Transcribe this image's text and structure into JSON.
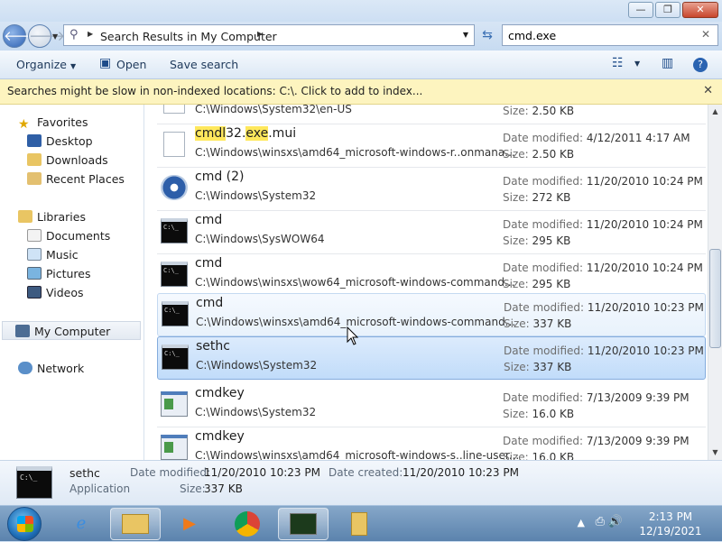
{
  "window": {
    "controls": {
      "minimize": "—",
      "maximize": "❐",
      "close": "✕"
    }
  },
  "address": {
    "crumb": "Search Results in My Computer",
    "search_value": "cmd.exe"
  },
  "toolbar": {
    "organize": "Organize",
    "open": "Open",
    "save_search": "Save search"
  },
  "infobar": {
    "message": "Searches might be slow in non-indexed locations: C:\\. Click to add to index..."
  },
  "navpane": {
    "favorites": {
      "label": "Favorites",
      "items": [
        "Desktop",
        "Downloads",
        "Recent Places"
      ]
    },
    "libraries": {
      "label": "Libraries",
      "items": [
        "Documents",
        "Music",
        "Pictures",
        "Videos"
      ]
    },
    "computer": "My Computer",
    "network": "Network"
  },
  "results": [
    {
      "name": "",
      "path": "C:\\Windows\\System32\\en-US",
      "date_label": "",
      "date": "",
      "size_label": "Size:",
      "size": "2.50 KB"
    },
    {
      "name_hl1": "cmdl",
      "name_mid": "32.",
      "name_hl2": "exe",
      "name_end": ".mui",
      "path": "C:\\Windows\\winsxs\\amd64_microsoft-windows-r..onmana...",
      "date_label": "Date modified:",
      "date": "4/12/2011 4:17 AM",
      "size_label": "Size:",
      "size": "2.50 KB"
    },
    {
      "name": "cmd (2)",
      "path": "C:\\Windows\\System32",
      "date_label": "Date modified:",
      "date": "11/20/2010 10:24 PM",
      "size_label": "Size:",
      "size": "272 KB"
    },
    {
      "name": "cmd",
      "path": "C:\\Windows\\SysWOW64",
      "date_label": "Date modified:",
      "date": "11/20/2010 10:24 PM",
      "size_label": "Size:",
      "size": "295 KB"
    },
    {
      "name": "cmd",
      "path": "C:\\Windows\\winsxs\\wow64_microsoft-windows-command...",
      "date_label": "Date modified:",
      "date": "11/20/2010 10:24 PM",
      "size_label": "Size:",
      "size": "295 KB"
    },
    {
      "name": "cmd",
      "path": "C:\\Windows\\winsxs\\amd64_microsoft-windows-command...",
      "date_label": "Date modified:",
      "date": "11/20/2010 10:23 PM",
      "size_label": "Size:",
      "size": "337 KB"
    },
    {
      "name": "sethc",
      "path": "C:\\Windows\\System32",
      "date_label": "Date modified:",
      "date": "11/20/2010 10:23 PM",
      "size_label": "Size:",
      "size": "337 KB"
    },
    {
      "name": "cmdkey",
      "path": "C:\\Windows\\System32",
      "date_label": "Date modified:",
      "date": "7/13/2009 9:39 PM",
      "size_label": "Size:",
      "size": "16.0 KB"
    },
    {
      "name": "cmdkey",
      "path": "C:\\Windows\\winsxs\\amd64_microsoft-windows-s..line-user...",
      "date_label": "Date modified:",
      "date": "7/13/2009 9:39 PM",
      "size_label": "Size:",
      "size": "16.0 KB"
    }
  ],
  "details": {
    "name": "sethc",
    "type": "Application",
    "date_modified_label": "Date modified:",
    "date_modified": "11/20/2010 10:23 PM",
    "date_created_label": "Date created:",
    "date_created": "11/20/2010 10:23 PM",
    "size_label": "Size:",
    "size": "337 KB"
  },
  "taskbar": {
    "clock_time": "2:13 PM",
    "clock_date": "12/19/2021"
  }
}
